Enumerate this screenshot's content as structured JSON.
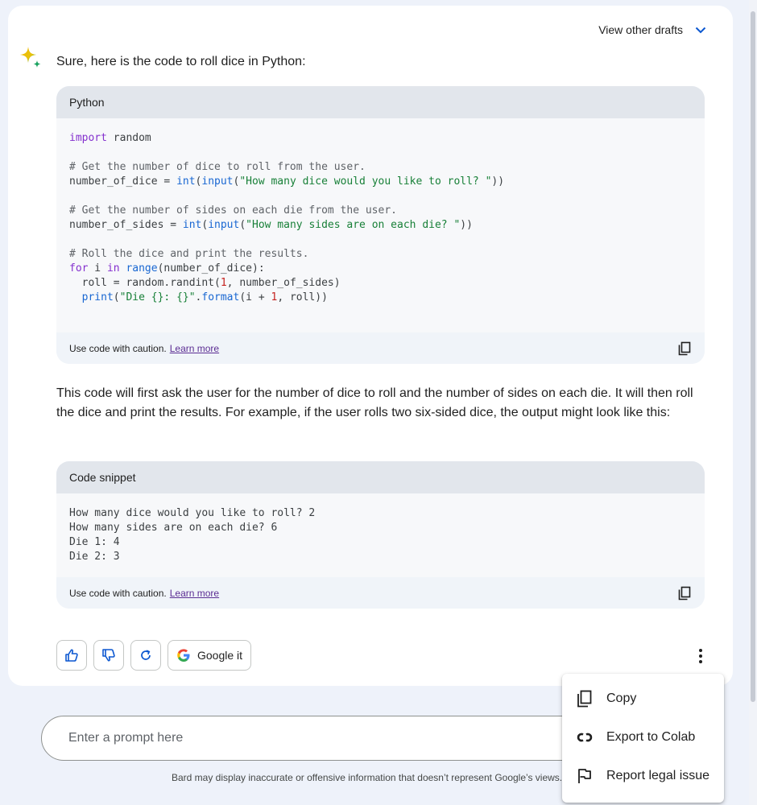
{
  "header": {
    "drafts_label": "View other drafts"
  },
  "response": {
    "intro": "Sure, here is the code to roll dice in Python:",
    "paragraph": "This code will first ask the user for the number of dice to roll and the number of sides on each die. It will then roll the dice and print the results. For example, if the user rolls two six-sided dice, the output might look like this:"
  },
  "code_blocks": [
    {
      "language": "Python",
      "lines": [
        "import random",
        "",
        "# Get the number of dice to roll from the user.",
        "number_of_dice = int(input(\"How many dice would you like to roll? \"))",
        "",
        "# Get the number of sides on each die from the user.",
        "number_of_sides = int(input(\"How many sides are on each die? \"))",
        "",
        "# Roll the dice and print the results.",
        "for i in range(number_of_dice):",
        "  roll = random.randint(1, number_of_sides)",
        "  print(\"Die {}: {}\".format(i + 1, roll))"
      ],
      "caution": "Use code with caution.",
      "learn_more": "Learn more"
    },
    {
      "language": "Code snippet",
      "lines": [
        "How many dice would you like to roll? 2",
        "How many sides are on each die? 6",
        "Die 1: 4",
        "Die 2: 3"
      ],
      "caution": "Use code with caution.",
      "learn_more": "Learn more"
    }
  ],
  "actions": {
    "google_it": "Google it"
  },
  "prompt": {
    "placeholder": "Enter a prompt here"
  },
  "disclaimer": "Bard may display inaccurate or offensive information that doesn’t represent Google’s views.",
  "menu": {
    "items": [
      {
        "label": "Copy",
        "icon": "copy-icon"
      },
      {
        "label": "Export to Colab",
        "icon": "colab-icon"
      },
      {
        "label": "Report legal issue",
        "icon": "flag-icon"
      }
    ]
  },
  "colors": {
    "accent": "#0b57d0",
    "background": "#eef2fa",
    "code_header": "#e2e6ec",
    "link": "#5b2d93"
  }
}
